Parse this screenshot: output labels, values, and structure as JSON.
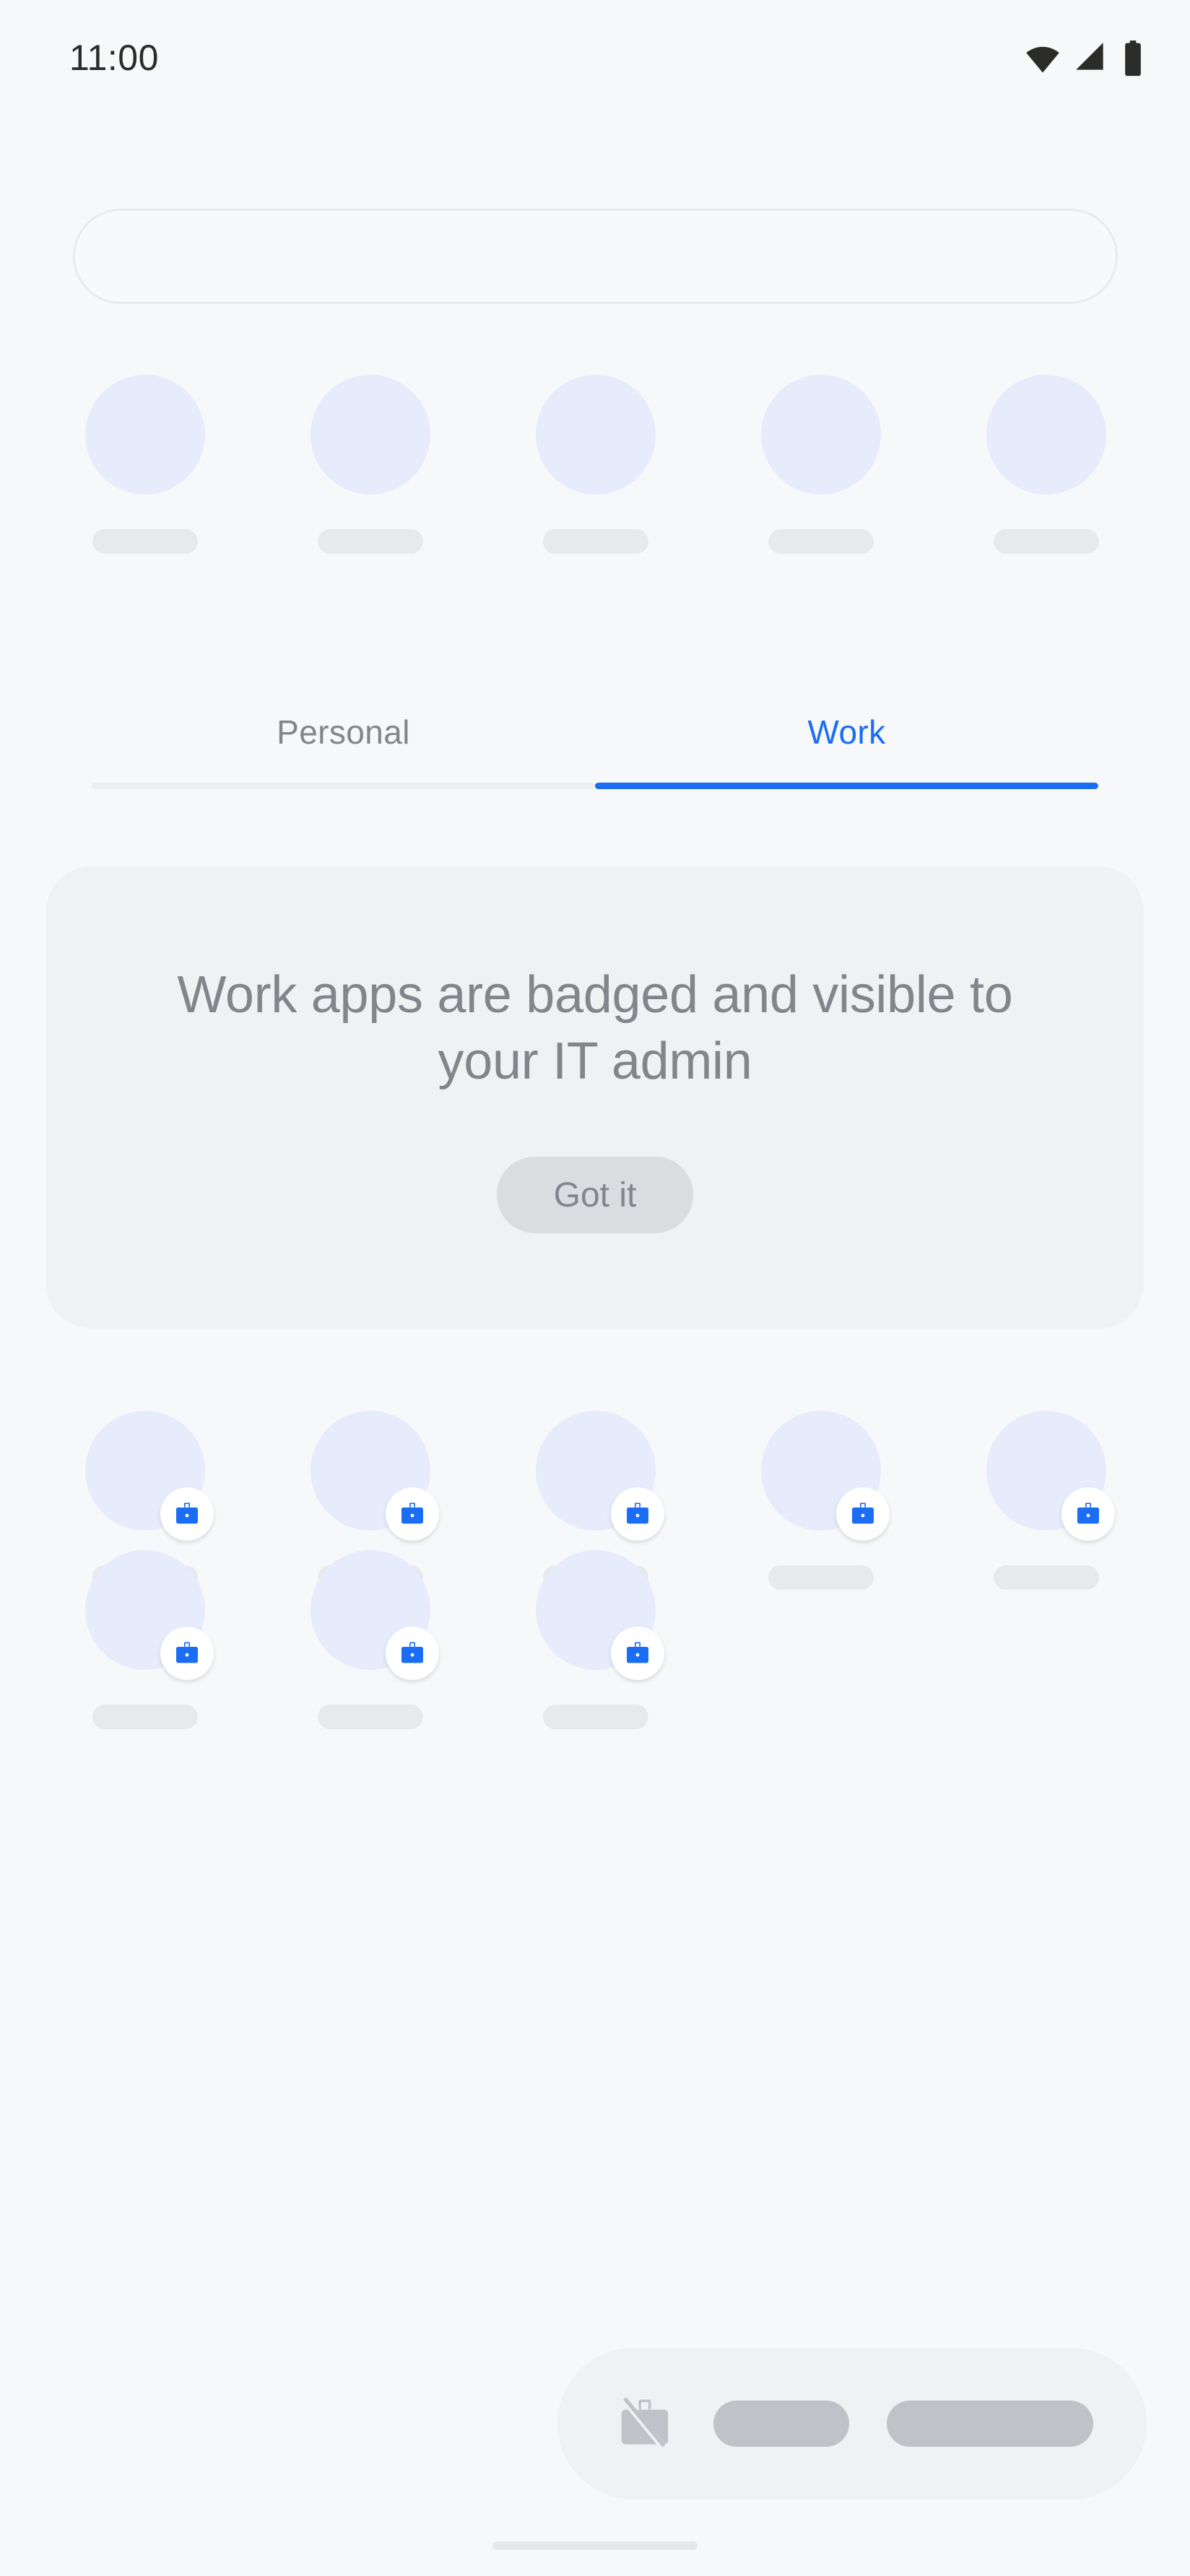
{
  "status_bar": {
    "clock": "11:00",
    "icons": [
      "wifi-icon",
      "cellular-signal-icon",
      "battery-icon"
    ]
  },
  "search": {
    "value": "",
    "placeholder": "",
    "name": "app-drawer-search-bar"
  },
  "tabs": {
    "items": [
      {
        "label": "Personal",
        "active": false
      },
      {
        "label": "Work",
        "active": true
      }
    ],
    "active_index": 1,
    "active_color": "#1b6ef3",
    "inactive_color": "#80868b"
  },
  "info_card": {
    "message": "Work apps are badged and visible to your IT admin",
    "button_label": "Got it",
    "background": "#f0f1f3",
    "text_color": "#80868b",
    "button_background": "#dadce0"
  },
  "app_rows": {
    "top_placeholder_row": {
      "count": 5,
      "badged": false,
      "icon_color": "#e6ecfb",
      "label_color": "#e8e9eb"
    },
    "work_row_1": {
      "count": 5,
      "badged": true,
      "badge_icon": "work-briefcase-badge-icon",
      "badge_color": "#1b6ef3",
      "icon_color": "#e6ecfb",
      "label_color": "#e8e9eb"
    },
    "work_row_2": {
      "count": 3,
      "badged": true,
      "badge_icon": "work-briefcase-badge-icon",
      "badge_color": "#1b6ef3",
      "icon_color": "#e6ecfb",
      "label_color": "#e8e9eb"
    }
  },
  "bottom_dock": {
    "toggle_icon": "work-profile-off-briefcase-icon",
    "pills": 2,
    "background": "#f0f1f3",
    "pill_color": "#bfc3c8"
  },
  "navigation": {
    "gesture_bar": "home-gesture-bar"
  },
  "theme": {
    "page_background": "#f7f8fa",
    "accent": "#1b6ef3",
    "muted_text": "#80868b"
  }
}
